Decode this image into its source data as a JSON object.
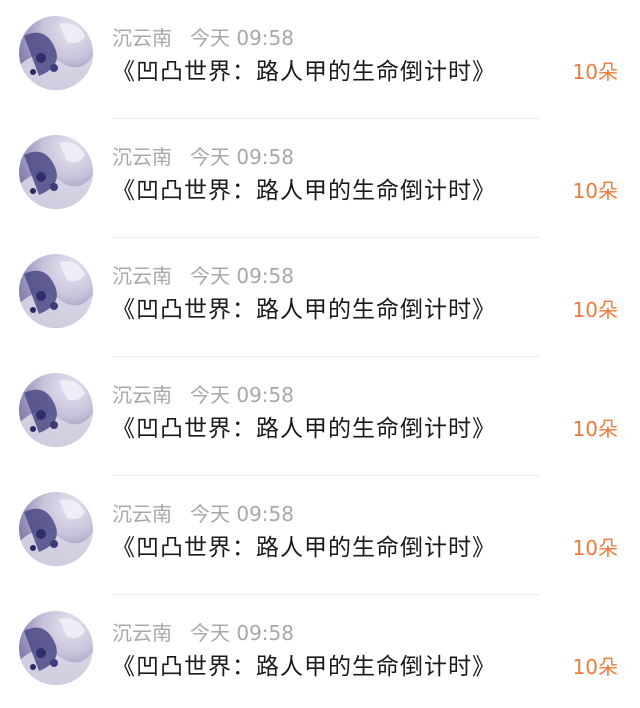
{
  "gift_list": {
    "items": [
      {
        "username": "沉云南",
        "time": "今天 09:58",
        "title": "《凹凸世界：路人甲的生命倒计时》",
        "amount": "10朵",
        "avatar_icon": "user-avatar-icon"
      },
      {
        "username": "沉云南",
        "time": "今天 09:58",
        "title": "《凹凸世界：路人甲的生命倒计时》",
        "amount": "10朵",
        "avatar_icon": "user-avatar-icon"
      },
      {
        "username": "沉云南",
        "time": "今天 09:58",
        "title": "《凹凸世界：路人甲的生命倒计时》",
        "amount": "10朵",
        "avatar_icon": "user-avatar-icon"
      },
      {
        "username": "沉云南",
        "time": "今天 09:58",
        "title": "《凹凸世界：路人甲的生命倒计时》",
        "amount": "10朵",
        "avatar_icon": "user-avatar-icon"
      },
      {
        "username": "沉云南",
        "time": "今天 09:58",
        "title": "《凹凸世界：路人甲的生命倒计时》",
        "amount": "10朵",
        "avatar_icon": "user-avatar-icon"
      },
      {
        "username": "沉云南",
        "time": "今天 09:58",
        "title": "《凹凸世界：路人甲的生命倒计时》",
        "amount": "10朵",
        "avatar_icon": "user-avatar-icon"
      }
    ]
  },
  "colors": {
    "background": "#ffffff",
    "meta_text": "#a8a8a8",
    "title_text": "#1a1a1a",
    "amount_accent": "#f07a3a",
    "divider": "#ececec"
  }
}
